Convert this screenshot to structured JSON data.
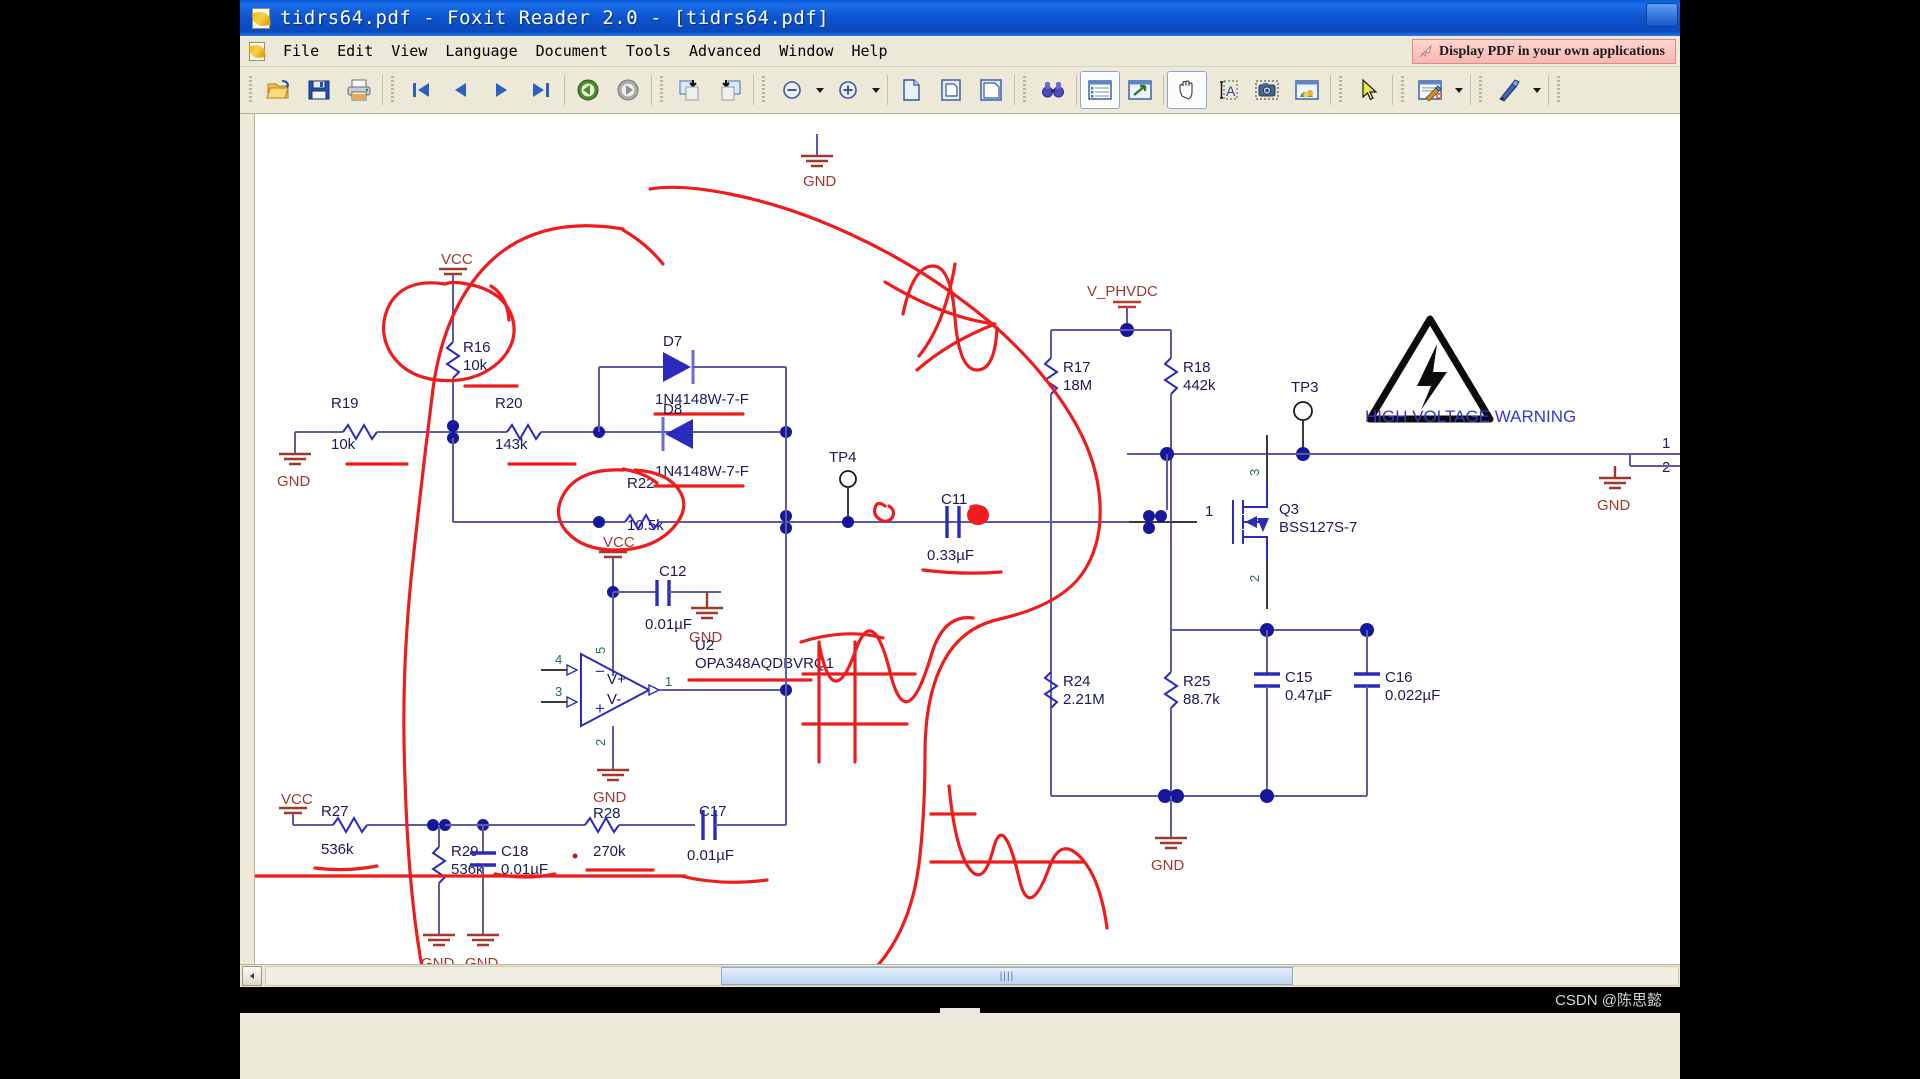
{
  "window": {
    "title": "tidrs64.pdf - Foxit Reader 2.0 - [tidrs64.pdf]",
    "app_icon": "pdf-document-icon"
  },
  "menubar": {
    "items": [
      "File",
      "Edit",
      "View",
      "Language",
      "Document",
      "Tools",
      "Advanced",
      "Window",
      "Help"
    ],
    "promo": "Display PDF in your own applications"
  },
  "toolbar": {
    "groups": [
      {
        "buttons": [
          {
            "name": "open-file-icon",
            "label": "Open"
          },
          {
            "name": "save-icon",
            "label": "Save"
          },
          {
            "name": "print-icon",
            "label": "Print"
          }
        ]
      },
      {
        "buttons": [
          {
            "name": "first-page-icon",
            "label": "First Page"
          },
          {
            "name": "previous-page-icon",
            "label": "Previous Page"
          },
          {
            "name": "next-page-icon",
            "label": "Next Page"
          },
          {
            "name": "last-page-icon",
            "label": "Last Page"
          }
        ]
      },
      {
        "buttons": [
          {
            "name": "go-back-icon",
            "label": "Previous View"
          },
          {
            "name": "go-forward-icon",
            "label": "Next View"
          }
        ]
      },
      {
        "buttons": [
          {
            "name": "rotate-clockwise-icon",
            "label": "Rotate Clockwise"
          },
          {
            "name": "rotate-counterclockwise-icon",
            "label": "Rotate Counterclockwise"
          }
        ]
      },
      {
        "buttons": [
          {
            "name": "zoom-out-icon",
            "label": "Zoom Out"
          },
          {
            "name": "zoom-in-icon",
            "label": "Zoom In"
          }
        ]
      },
      {
        "buttons": [
          {
            "name": "actual-size-icon",
            "label": "Actual Size"
          },
          {
            "name": "fit-page-icon",
            "label": "Fit Page"
          },
          {
            "name": "fit-width-icon",
            "label": "Fit Width"
          }
        ]
      },
      {
        "buttons": [
          {
            "name": "find-icon",
            "label": "Find"
          }
        ]
      },
      {
        "buttons": [
          {
            "name": "bookmarks-panel-icon",
            "label": "Show/Hide Navigation Panel"
          },
          {
            "name": "full-screen-icon",
            "label": "Full Screen"
          }
        ]
      },
      {
        "buttons": [
          {
            "name": "hand-tool-icon",
            "label": "Hand Tool",
            "active": true
          },
          {
            "name": "select-text-icon",
            "label": "Select Text"
          },
          {
            "name": "snapshot-icon",
            "label": "Snapshot"
          },
          {
            "name": "image-tool-icon",
            "label": "Select Image"
          }
        ]
      },
      {
        "buttons": [
          {
            "name": "pointer-select-icon",
            "label": "Select Annotation"
          }
        ]
      },
      {
        "buttons": [
          {
            "name": "annotation-tools-icon",
            "label": "Commenting Tools"
          }
        ]
      },
      {
        "buttons": [
          {
            "name": "drawing-markup-icon",
            "label": "Drawing Markup Tools"
          }
        ]
      }
    ]
  },
  "scrollbar": {
    "left_arrow": "◀",
    "right_arrow": "▶",
    "grip": "||||"
  },
  "status": {
    "watermark": "CSDN @陈思懿"
  },
  "schematic": {
    "nets": [
      {
        "name": "VCC",
        "label": "VCC"
      },
      {
        "name": "VCC-2",
        "label": "VCC"
      },
      {
        "name": "VCC-3",
        "label": "VCC"
      },
      {
        "name": "V_PHVDC",
        "label": "V_PHVDC"
      },
      {
        "name": "GND",
        "label": "GND"
      }
    ],
    "gnd_label": "GND",
    "vcc_label": "VCC",
    "vphvdc_label": "V_PHVDC",
    "warning_text": "HIGH VOLTAGE WARNING",
    "components": [
      {
        "ref": "R16",
        "value": "10k"
      },
      {
        "ref": "R19",
        "value": "10k"
      },
      {
        "ref": "R20",
        "value": "143k"
      },
      {
        "ref": "R22",
        "value": "10.5k"
      },
      {
        "ref": "R27",
        "value": "536k"
      },
      {
        "ref": "R28",
        "value": "270k"
      },
      {
        "ref": "R29",
        "value": "536k"
      },
      {
        "ref": "R17",
        "value": "18M"
      },
      {
        "ref": "R18",
        "value": "442k"
      },
      {
        "ref": "R24",
        "value": "2.21M"
      },
      {
        "ref": "R25",
        "value": "88.7k"
      },
      {
        "ref": "C11",
        "value": "0.33µF"
      },
      {
        "ref": "C12",
        "value": "0.01µF"
      },
      {
        "ref": "C15",
        "value": "0.47µF"
      },
      {
        "ref": "C16",
        "value": "0.022µF"
      },
      {
        "ref": "C17",
        "value": "0.01µF"
      },
      {
        "ref": "C18",
        "value": "0.01µF"
      },
      {
        "ref": "D7",
        "value": "1N4148W-7-F"
      },
      {
        "ref": "D8",
        "value": "1N4148W-7-F"
      },
      {
        "ref": "U2",
        "value": "OPA348AQDBVRQ1"
      },
      {
        "ref": "Q3",
        "value": "BSS127S-7"
      },
      {
        "ref": "TP3",
        "value": ""
      },
      {
        "ref": "TP4",
        "value": ""
      }
    ],
    "labels": {
      "r16_ref": "R16",
      "r16_val": "10k",
      "r19_ref": "R19",
      "r19_val": "10k",
      "r20_ref": "R20",
      "r20_val": "143k",
      "r22_ref": "R22",
      "r22_val": "10.5k",
      "r27_ref": "R27",
      "r27_val": "536k",
      "r28_ref": "R28",
      "r28_val": "270k",
      "r29_ref": "R29",
      "r29_val": "536k",
      "r17_ref": "R17",
      "r17_val": "18M",
      "r18_ref": "R18",
      "r18_val": "442k",
      "r24_ref": "R24",
      "r24_val": "2.21M",
      "r25_ref": "R25",
      "r25_val": "88.7k",
      "c11_ref": "C11",
      "c11_val": "0.33µF",
      "c12_ref": "C12",
      "c12_val": "0.01µF",
      "c15_ref": "C15",
      "c15_val": "0.47µF",
      "c16_ref": "C16",
      "c16_val": "0.022µF",
      "c17_ref": "C17",
      "c17_val": "0.01µF",
      "c18_ref": "C18",
      "c18_val": "0.01µF",
      "d7_ref": "D7",
      "d7_val": "1N4148W-7-F",
      "d8_ref": "D8",
      "d8_val": "1N4148W-7-F",
      "u2_ref": "U2",
      "u2_val": "OPA348AQDBVRQ1",
      "q3_ref": "Q3",
      "q3_val": "BSS127S-7",
      "tp3": "TP3",
      "tp4": "TP4",
      "pin1": "1",
      "pin2": "2",
      "pin3": "3",
      "pin4": "4",
      "pin5": "5",
      "pin_q1": "1",
      "pin_q2": "2",
      "pin_q3": "3",
      "conn1": "1",
      "conn2": "2",
      "vplus": "V+",
      "vminus": "V-",
      "opamp_minus": "−",
      "opamp_plus": "+"
    },
    "colors": {
      "wire": "#5b5ba8",
      "wire_dark": "#3a3a3a",
      "label_text": "#1a1a5a",
      "net_text": "#a0392c",
      "component_blue": "#2b2bbb",
      "annotation_red": "#ee1c1c",
      "warning_blue": "#3838cc"
    }
  }
}
